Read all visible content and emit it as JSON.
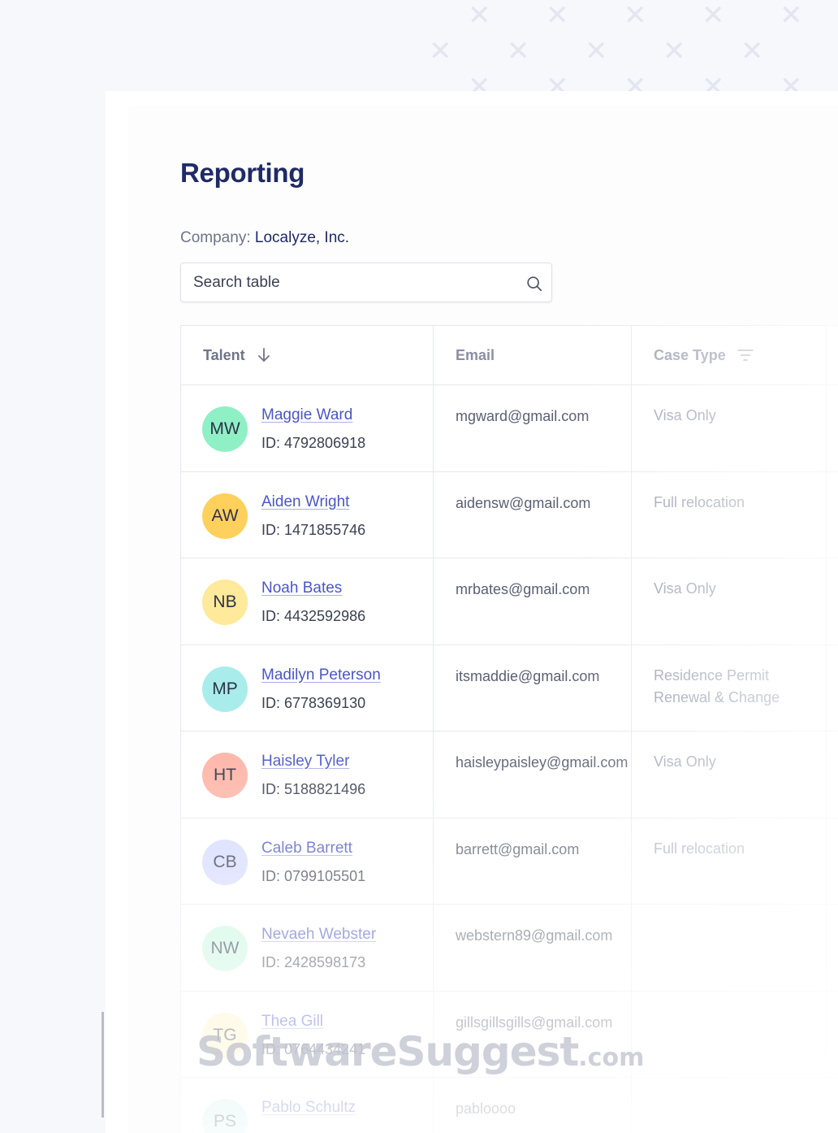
{
  "page": {
    "title": "Reporting",
    "company_label": "Company:",
    "company_name": "Localyze, Inc."
  },
  "search": {
    "placeholder": "Search table",
    "icon": "search-icon"
  },
  "table": {
    "columns": [
      {
        "label": "Talent",
        "icon": "sort-arrow-down-icon"
      },
      {
        "label": "Email",
        "icon": ""
      },
      {
        "label": "Case Type",
        "icon": "filter-icon"
      }
    ],
    "rows": [
      {
        "initials": "MW",
        "name": "Maggie Ward",
        "id": "ID: 4792806918",
        "email": "mgward@gmail.com",
        "case_type": "Visa Only",
        "avatar_color": "#8ff0c6"
      },
      {
        "initials": "AW",
        "name": "Aiden Wright",
        "id": "ID: 1471855746",
        "email": "aidensw@gmail.com",
        "case_type": "Full relocation",
        "avatar_color": "#ffd15c"
      },
      {
        "initials": "NB",
        "name": "Noah Bates",
        "id": "ID: 4432592986",
        "email": "mrbates@gmail.com",
        "case_type": "Visa Only",
        "avatar_color": "#ffe99a"
      },
      {
        "initials": "MP",
        "name": "Madilyn Peterson",
        "id": "ID: 6778369130",
        "email": "itsmaddie@gmail.com",
        "case_type": "Residence Permit Renewal & Change",
        "avatar_color": "#a9ecec"
      },
      {
        "initials": "HT",
        "name": "Haisley Tyler",
        "id": "ID: 5188821496",
        "email": "haisleypaisley@gmail.com",
        "case_type": "Visa Only",
        "avatar_color": "#ffb4a6"
      },
      {
        "initials": "CB",
        "name": "Caleb Barrett",
        "id": "ID: 0799105501",
        "email": "barrett@gmail.com",
        "case_type": "Full relocation",
        "avatar_color": "#d6daff"
      },
      {
        "initials": "NW",
        "name": "Nevaeh Webster",
        "id": "ID: 2428598173",
        "email": "webstern89@gmail.com",
        "case_type": "",
        "avatar_color": "#c8f7df"
      },
      {
        "initials": "TG",
        "name": "Thea Gill",
        "id": "ID: 0764434241",
        "email": "gillsgillsgills@gmail.com",
        "case_type": "",
        "avatar_color": "#fff2c2"
      },
      {
        "initials": "PS",
        "name": "Pablo Schultz",
        "id": "",
        "email": "pabloooo",
        "case_type": "",
        "avatar_color": "#cdf3ec"
      }
    ]
  },
  "watermark": {
    "text": "SoftwareSuggest",
    "suffix": ".com"
  }
}
